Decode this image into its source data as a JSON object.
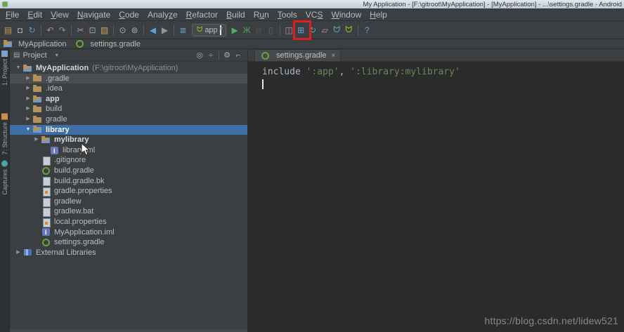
{
  "title_bar": {
    "title": "My Application - [F:\\gitroot\\MyApplication] - [MyApplication] - ...\\settings.gradle - Android"
  },
  "icons": {
    "chevron_down": "▾",
    "panel_folder": "▤"
  },
  "menu": {
    "items": [
      {
        "name": "menu-file",
        "pre": "",
        "key": "F",
        "post": "ile"
      },
      {
        "name": "menu-edit",
        "pre": "",
        "key": "E",
        "post": "dit"
      },
      {
        "name": "menu-view",
        "pre": "",
        "key": "V",
        "post": "iew"
      },
      {
        "name": "menu-navigate",
        "pre": "",
        "key": "N",
        "post": "avigate"
      },
      {
        "name": "menu-code",
        "pre": "",
        "key": "C",
        "post": "ode"
      },
      {
        "name": "menu-analyze",
        "pre": "Analy",
        "key": "z",
        "post": "e"
      },
      {
        "name": "menu-refactor",
        "pre": "",
        "key": "R",
        "post": "efactor"
      },
      {
        "name": "menu-build",
        "pre": "",
        "key": "B",
        "post": "uild"
      },
      {
        "name": "menu-run",
        "pre": "R",
        "key": "u",
        "post": "n"
      },
      {
        "name": "menu-tools",
        "pre": "",
        "key": "T",
        "post": "ools"
      },
      {
        "name": "menu-vcs",
        "pre": "VC",
        "key": "S",
        "post": ""
      },
      {
        "name": "menu-window",
        "pre": "",
        "key": "W",
        "post": "indow"
      },
      {
        "name": "menu-help",
        "pre": "",
        "key": "H",
        "post": "elp"
      }
    ]
  },
  "toolbar": {
    "run_config": {
      "label": "app"
    },
    "left": [
      {
        "name": "open-file-icon",
        "glyph": "▤",
        "color": "#c49a5a",
        "inter": "true"
      },
      {
        "name": "save-all-icon",
        "glyph": "◘",
        "color": "#9aa7b3",
        "inter": "true"
      },
      {
        "name": "synchronize-icon",
        "glyph": "↻",
        "color": "#5493ce",
        "inter": "true"
      },
      {
        "name": "separator",
        "cls": "sep",
        "glyph": "",
        "inter": "false"
      },
      {
        "name": "undo-icon",
        "glyph": "↶",
        "color": "#b284c0",
        "inter": "true"
      },
      {
        "name": "redo-icon",
        "glyph": "↷",
        "color": "#8f969c",
        "inter": "true"
      },
      {
        "name": "separator",
        "cls": "sep",
        "glyph": "",
        "inter": "false"
      },
      {
        "name": "cut-icon",
        "glyph": "✂",
        "color": "#c786b5",
        "inter": "true"
      },
      {
        "name": "copy-icon",
        "glyph": "⊡",
        "color": "#a3aab1",
        "inter": "true"
      },
      {
        "name": "paste-icon",
        "glyph": "▨",
        "color": "#c9a05e",
        "inter": "true"
      },
      {
        "name": "separator",
        "cls": "sep",
        "glyph": "",
        "inter": "false"
      },
      {
        "name": "find-icon",
        "glyph": "⊙",
        "color": "#a8b0b8",
        "inter": "true"
      },
      {
        "name": "replace-icon",
        "glyph": "⊚",
        "color": "#a8b0b8",
        "inter": "true"
      },
      {
        "name": "separator",
        "cls": "sep",
        "glyph": "",
        "inter": "false"
      },
      {
        "name": "back-icon",
        "glyph": "◀",
        "color": "#58a0d8",
        "inter": "true"
      },
      {
        "name": "forward-icon",
        "glyph": "▶",
        "color": "#8f969c",
        "inter": "true"
      },
      {
        "name": "separator",
        "cls": "sep",
        "glyph": "",
        "inter": "false"
      },
      {
        "name": "make-project-icon",
        "glyph": "≣",
        "color": "#5fa8b5",
        "inter": "true"
      }
    ],
    "right": [
      {
        "name": "run-icon",
        "glyph": "▶",
        "color": "#4fae58",
        "inter": "true"
      },
      {
        "name": "debug-icon",
        "glyph": "Ж",
        "color": "#55a05a",
        "inter": "true"
      },
      {
        "name": "run-coverage-icon",
        "glyph": "⊘",
        "color": "#6b6f72",
        "cls": "dis",
        "inter": "true"
      },
      {
        "name": "attach-debugger-icon",
        "glyph": "▯",
        "color": "#8c97a3",
        "cls": "dis",
        "inter": "true"
      },
      {
        "name": "separator",
        "cls": "sep",
        "glyph": "",
        "inter": "false"
      },
      {
        "name": "android-monitor-icon",
        "glyph": "◫",
        "color": "#c786b5",
        "inter": "true"
      },
      {
        "name": "project-structure-icon",
        "glyph": "⊞",
        "color": "#6fa3cc",
        "inter": "true"
      },
      {
        "name": "sync-gradle-icon",
        "glyph": "↻",
        "color": "#4fb3a8",
        "inter": "true"
      },
      {
        "name": "avd-manager-icon",
        "glyph": "▱",
        "color": "#cc8ccc",
        "inter": "true"
      },
      {
        "name": "sdk-manager-icon",
        "glyph": "ᗢ",
        "color": "#58a8b8",
        "inter": "true"
      },
      {
        "name": "android-device-icon",
        "glyph": "ᗢ",
        "color": "#97c024",
        "inter": "true"
      },
      {
        "name": "separator",
        "cls": "sep",
        "glyph": "",
        "inter": "false"
      },
      {
        "name": "help-icon",
        "glyph": "?",
        "color": "#58a0d8",
        "inter": "true"
      }
    ]
  },
  "navbar": {
    "crumbs": [
      {
        "label": "MyApplication",
        "icon": "folder mod",
        "iconname": "project-folder-icon"
      },
      {
        "label": "settings.gradle",
        "icon": "gradle",
        "iconname": "gradle-file-icon"
      }
    ]
  },
  "stripe": {
    "items": [
      {
        "name": "tool-button-project",
        "label": "1: Project",
        "icn": "si-proj",
        "mt": 2
      },
      {
        "name": "tool-button-structure",
        "label": "7: Structure",
        "icn": "si-struct",
        "mt": 40
      },
      {
        "name": "tool-button-captures",
        "label": "Captures",
        "icn": "si-capt",
        "mt": 8
      }
    ]
  },
  "panel": {
    "header": {
      "title": "Project",
      "icons": [
        {
          "name": "locate-icon",
          "glyph": "◎",
          "inter": "true"
        },
        {
          "name": "collapse-all-icon",
          "glyph": "÷",
          "inter": "true"
        },
        {
          "name": "separator",
          "glyph": "",
          "cls": "hsep",
          "inter": "false"
        },
        {
          "name": "gear-icon",
          "glyph": "⚙",
          "inter": "true"
        },
        {
          "name": "hide-panel-icon",
          "glyph": "⌐",
          "inter": "true"
        }
      ]
    },
    "tree": [
      {
        "label": "MyApplication",
        "meta": "(F:\\gitroot\\MyApplication)",
        "arrow": "▼",
        "icon": "folder mod",
        "iconname": "project-folder-icon",
        "cls": "b",
        "pad": 6
      },
      {
        "label": ".gradle",
        "meta": "",
        "arrow": "▶",
        "icon": "folder",
        "iconname": "folder-icon",
        "cls": "hov",
        "pad": 20
      },
      {
        "label": ".idea",
        "meta": "",
        "arrow": "▶",
        "icon": "folder",
        "iconname": "folder-icon",
        "pad": 20
      },
      {
        "label": "app",
        "meta": "",
        "arrow": "▶",
        "icon": "folder mod",
        "iconname": "module-folder-icon",
        "cls": "b",
        "pad": 20
      },
      {
        "label": "build",
        "meta": "",
        "arrow": "▶",
        "icon": "folder",
        "iconname": "folder-icon",
        "pad": 20
      },
      {
        "label": "gradle",
        "meta": "",
        "arrow": "▶",
        "icon": "folder",
        "iconname": "folder-icon",
        "pad": 20
      },
      {
        "label": "library",
        "meta": "",
        "arrow": "▼",
        "icon": "folder mod",
        "iconname": "module-folder-icon",
        "cls": "b sel",
        "pad": 20
      },
      {
        "label": "mylibrary",
        "meta": "",
        "arrow": "▶",
        "icon": "folder mod",
        "iconname": "module-folder-icon",
        "cls": "b",
        "pad": 32
      },
      {
        "label": "library.iml",
        "meta": "",
        "arrow": "",
        "icon": "iml",
        "iconname": "iml-file-icon",
        "pad": 44
      },
      {
        "label": ".gitignore",
        "meta": "",
        "arrow": "",
        "icon": "file",
        "iconname": "file-icon",
        "pad": 32
      },
      {
        "label": "build.gradle",
        "meta": "",
        "arrow": "",
        "icon": "gradle",
        "iconname": "gradle-file-icon",
        "pad": 32
      },
      {
        "label": "build.gradle.bk",
        "meta": "",
        "arrow": "",
        "icon": "file",
        "iconname": "file-icon",
        "pad": 32
      },
      {
        "label": "gradle.properties",
        "meta": "",
        "arrow": "",
        "icon": "props",
        "iconname": "properties-file-icon",
        "pad": 32
      },
      {
        "label": "gradlew",
        "meta": "",
        "arrow": "",
        "icon": "file",
        "iconname": "file-icon",
        "pad": 32
      },
      {
        "label": "gradlew.bat",
        "meta": "",
        "arrow": "",
        "icon": "file",
        "iconname": "file-icon",
        "pad": 32
      },
      {
        "label": "local.properties",
        "meta": "",
        "arrow": "",
        "icon": "props",
        "iconname": "properties-file-icon",
        "pad": 32
      },
      {
        "label": "MyApplication.iml",
        "meta": "",
        "arrow": "",
        "icon": "iml",
        "iconname": "iml-file-icon",
        "pad": 32
      },
      {
        "label": "settings.gradle",
        "meta": "",
        "arrow": "",
        "icon": "gradle",
        "iconname": "gradle-file-icon",
        "pad": 32
      },
      {
        "label": "External Libraries",
        "meta": "",
        "arrow": "▶",
        "icon": "extlib",
        "iconname": "external-libraries-icon",
        "pad": 6
      }
    ]
  },
  "editor": {
    "tab": {
      "label": "settings.gradle",
      "close": "×"
    },
    "code": {
      "tokens": [
        {
          "t": "include ",
          "c": "pln"
        },
        {
          "t": "':app'",
          "c": "str"
        },
        {
          "t": ", ",
          "c": "pln"
        },
        {
          "t": "':library:mylibrary'",
          "c": "str"
        }
      ]
    }
  },
  "watermark": {
    "text": "https://blog.csdn.net/lidew521"
  },
  "colors": {
    "selection_blue": "#3d6ea8",
    "string_green": "#6a8759",
    "code_text": "#a9b7c6",
    "highlight_red": "#dc2020",
    "panel_bg": "#3c3f41",
    "editor_bg": "#2b2b2b",
    "titlebar_bg": "#ccd5e0"
  }
}
